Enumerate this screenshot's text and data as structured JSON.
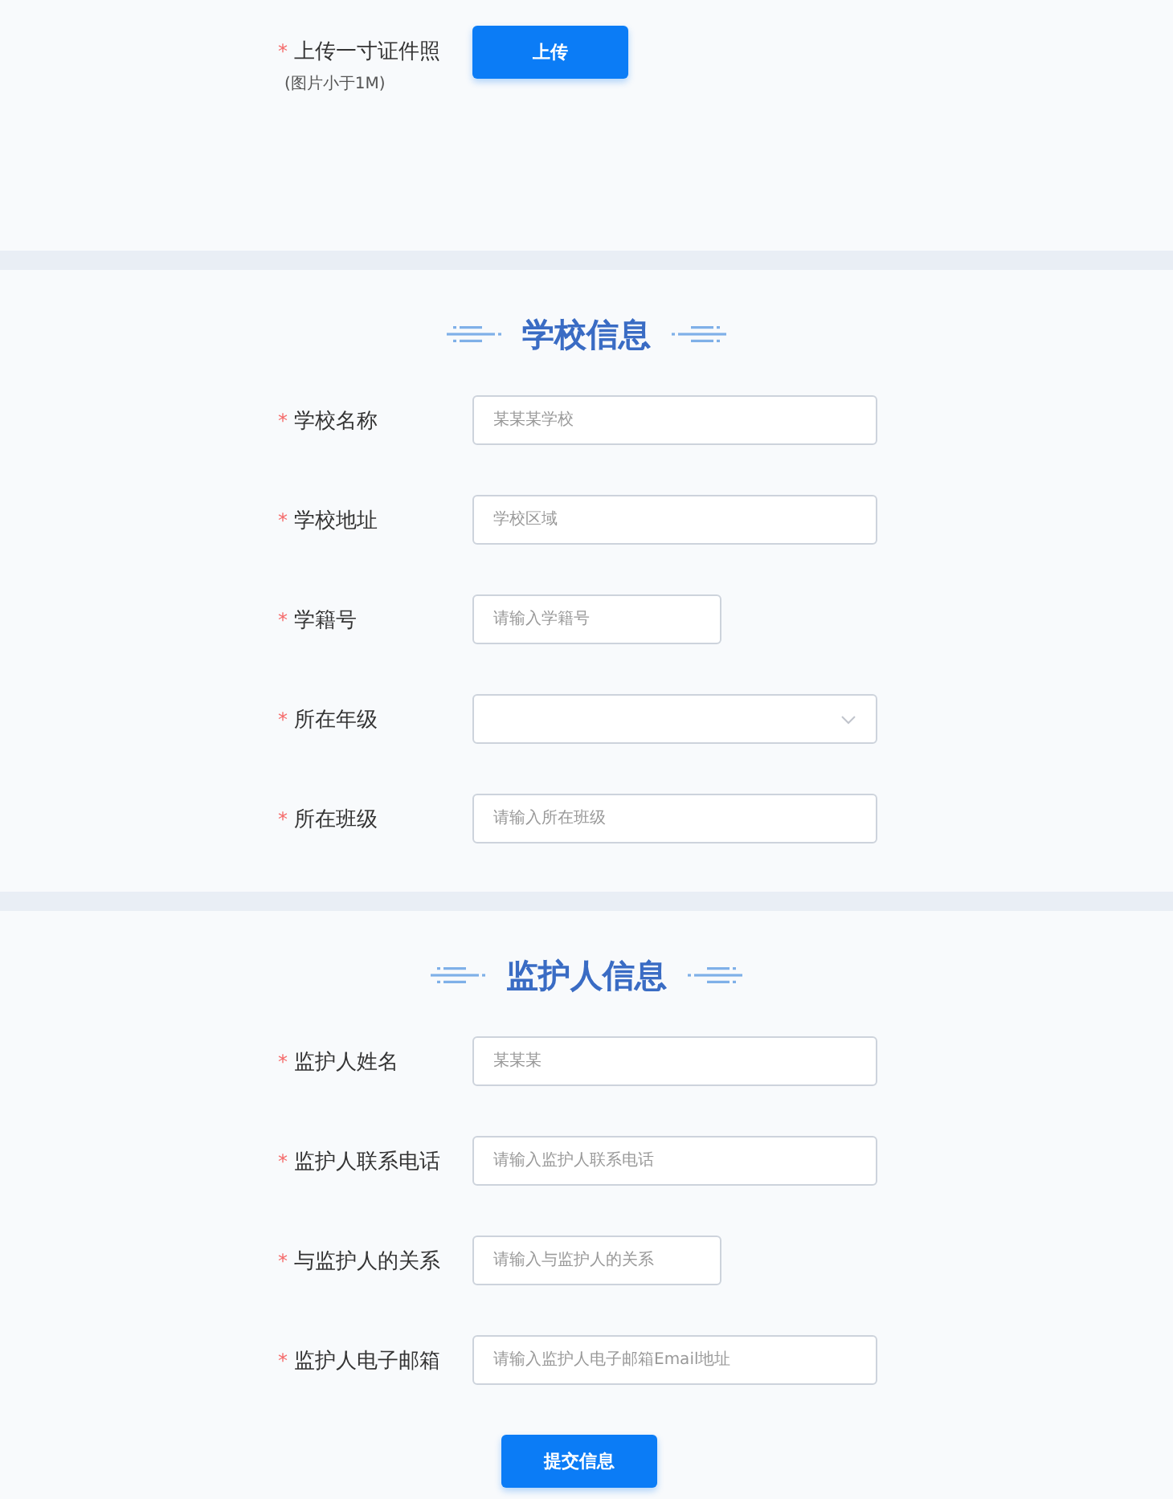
{
  "upload": {
    "label": "上传一寸证件照",
    "mark": "*",
    "hint": "(图片小于1M)",
    "button": "上传"
  },
  "sections": [
    {
      "title": "学校信息",
      "fields": [
        {
          "label": "学校名称",
          "mark": "*",
          "kind": "input",
          "placeholder": "某某某学校"
        },
        {
          "label": "学校地址",
          "mark": "*",
          "kind": "input",
          "placeholder": "学校区域"
        },
        {
          "label": "学籍号",
          "mark": "*",
          "kind": "short",
          "placeholder": "请输入学籍号"
        },
        {
          "label": "所在年级",
          "mark": "*",
          "kind": "select"
        },
        {
          "label": "所在班级",
          "mark": "*",
          "kind": "input",
          "placeholder": "请输入所在班级"
        }
      ]
    },
    {
      "title": "监护人信息",
      "fields": [
        {
          "label": "监护人姓名",
          "mark": "*",
          "kind": "input",
          "placeholder": "某某某"
        },
        {
          "label": "监护人联系电话",
          "mark": "*",
          "kind": "input",
          "placeholder": "请输入监护人联系电话"
        },
        {
          "label": "与监护人的关系",
          "mark": "*",
          "kind": "short",
          "placeholder": "请输入与监护人的关系"
        },
        {
          "label": "监护人电子邮箱",
          "mark": "*",
          "kind": "input",
          "placeholder": "请输入监护人电子邮箱Email地址"
        }
      ]
    }
  ],
  "submit": "提交信息"
}
